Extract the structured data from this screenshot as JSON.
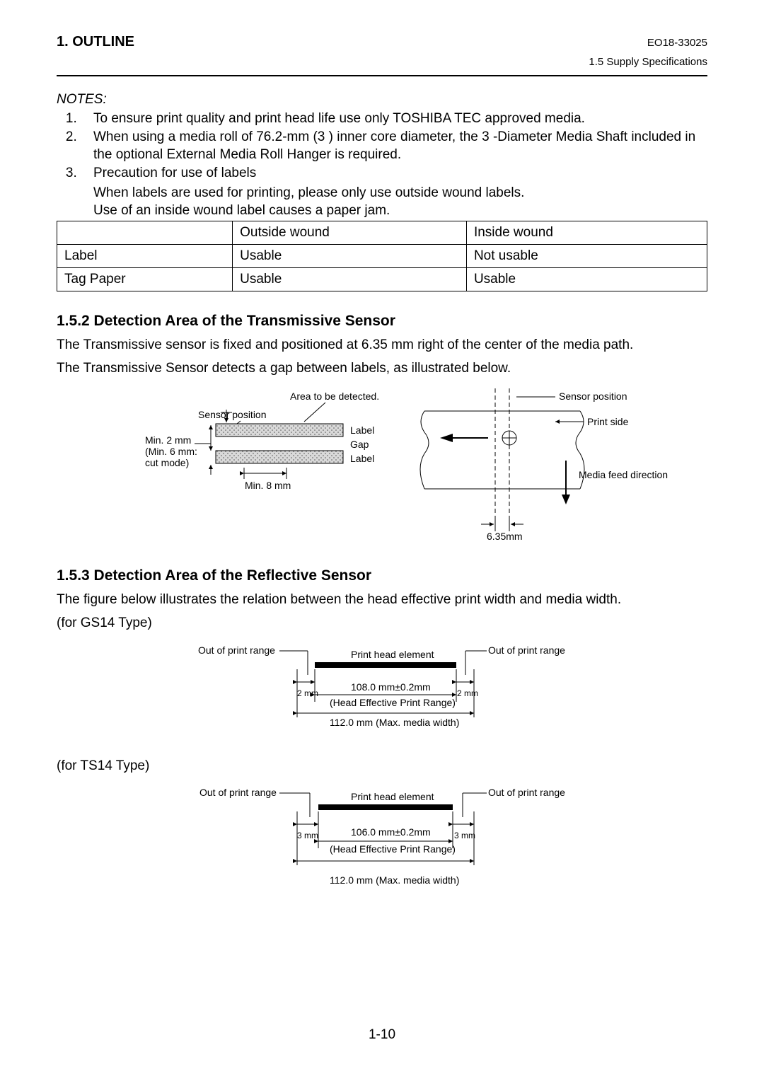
{
  "header": {
    "section_title": "1. OUTLINE",
    "doc_id": "EO18-33025",
    "subsection_ref": "1.5  Supply  Specifications"
  },
  "notes": {
    "heading": "NOTES:",
    "items": [
      "To ensure print quality and print head life use only TOSHIBA TEC approved media.",
      "When using a media roll of 76.2-mm (3 ) inner core diameter, the 3 -Diameter Media Shaft included in the optional External Media Roll Hanger is required.",
      "Precaution for use of labels"
    ],
    "item3_line2": "When labels are used for printing, please only use outside wound labels.",
    "item3_line3": "Use of an inside wound label causes a paper jam."
  },
  "table": {
    "headers": {
      "blank": "",
      "outside": "Outside wound",
      "inside": "Inside wound"
    },
    "rows": [
      {
        "name": "Label",
        "outside": "Usable",
        "inside": "Not usable"
      },
      {
        "name": "Tag Paper",
        "outside": "Usable",
        "inside": "Usable"
      }
    ]
  },
  "sec152": {
    "title": "1.5.2 Detection Area of the Transmissive Sensor",
    "p1": "The Transmissive sensor is fixed and positioned at 6.35 mm right of the center of the media path.",
    "p2": "The Transmissive Sensor detects a gap between labels, as illustrated below.",
    "diag": {
      "area_detected": "Area to be detected.",
      "sensor_position": "Sensor position",
      "label": "Label",
      "gap": "Gap",
      "min2": "Min. 2 mm",
      "min6a": "(Min. 6 mm:",
      "min6b": "cut mode)",
      "min8": "Min. 8 mm",
      "print_side": "Print side",
      "media_feed": "Media feed direction",
      "offset": "6.35mm"
    }
  },
  "sec153": {
    "title": "1.5.3 Detection Area of the Reflective Sensor",
    "p1": "The figure below illustrates the relation between the head effective print width and media width.",
    "gs14_label": "(for GS14 Type)",
    "ts14_label": "(for TS14 Type)",
    "common": {
      "out_of_range": "Out of print range",
      "print_head_elem": "Print head element",
      "herange": "(Head Effective Print Range)",
      "max_media": "112.0 mm (Max. media width)"
    },
    "gs14": {
      "margin": "2 mm",
      "width": "108.0 mm±0.2mm"
    },
    "ts14": {
      "margin": "3 mm",
      "width": "106.0 mm±0.2mm"
    }
  },
  "page_number": "1-10"
}
